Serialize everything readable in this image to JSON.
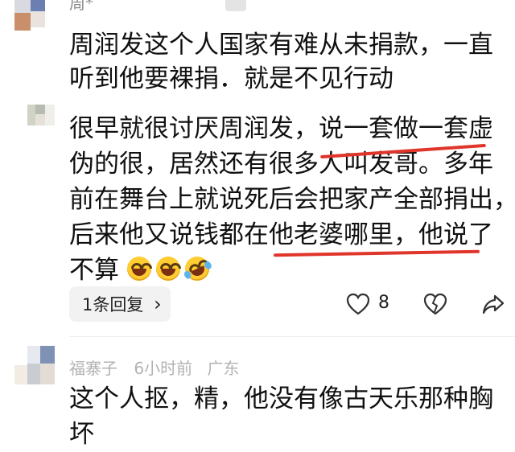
{
  "comments": [
    {
      "username": "周*",
      "lines": [
        "周润发这个人国家有难从未捐款，一直",
        "听到他要裸捐．就是不见行动"
      ]
    },
    {
      "lines": [
        "很早就很讨厌周润发，说一套做一套虚",
        "伪的很，居然还有很多人叫发哥。多年",
        "前在舞台上就说死后会把家产全部捐出，",
        "后来他又说钱都在他老婆哪里，他说了",
        "不算"
      ],
      "emojis": [
        "grinning-face-icon",
        "grinning-face-icon",
        "rolling-laughing-face-icon"
      ],
      "reply_count_label": "1条回复",
      "reply_chevron": "›",
      "like_count": "8"
    },
    {
      "username": "福寨子",
      "time": "6小时前",
      "location": "广东",
      "lines": [
        "这个人抠，精，他没有像古天乐那种胸",
        "坏"
      ]
    }
  ],
  "colors": {
    "underline": "#e0352b",
    "meta": "#8a8a8a"
  }
}
